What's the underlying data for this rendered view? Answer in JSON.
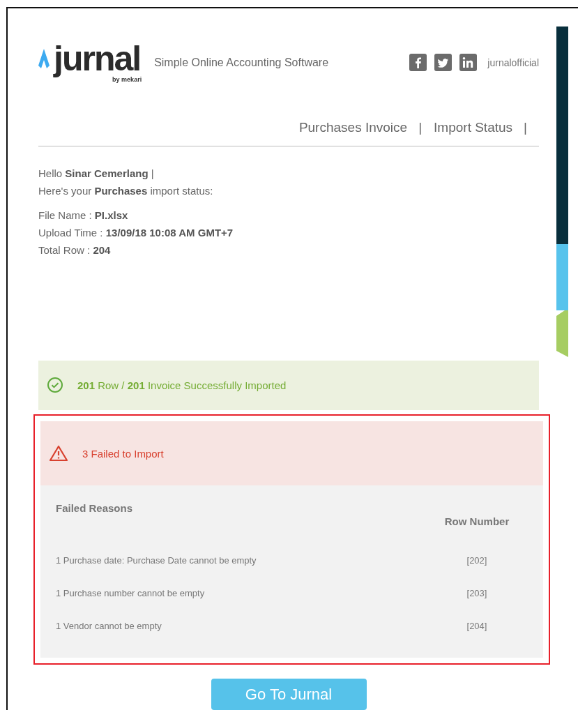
{
  "header": {
    "logo": {
      "name": "jurnal",
      "byline": "by mekari"
    },
    "tagline": "Simple Online Accounting Software",
    "social_handle": "jurnalofficial"
  },
  "nav": [
    {
      "label": "Purchases Invoice",
      "separator": "|"
    },
    {
      "label": "Import Status",
      "separator": "|"
    }
  ],
  "greeting": [
    "Hello **Sinar Cemerlang** |",
    "Here's your **Purchases** import status:"
  ],
  "file_info": [
    "File Name : **PI.xlsx**",
    "Upload Time : **13/09/18 10:08 AM GMT+7**",
    "Total Row : **204**"
  ],
  "success": {
    "text": "**201** Row / **201** Invoice Successfully Imported"
  },
  "failure": {
    "text": "3 Failed to Import",
    "highlighted": true,
    "columns": [
      "Failed Reasons",
      "Row Number"
    ],
    "rows": [
      {
        "reason": "1 Purchase date: Purchase Date cannot be empty",
        "row": "[202]"
      },
      {
        "reason": "1 Purchase number cannot be empty",
        "row": "[203]"
      },
      {
        "reason": "1 Vendor cannot be empty",
        "row": "[204]"
      }
    ]
  },
  "button": "Go To Jurnal"
}
